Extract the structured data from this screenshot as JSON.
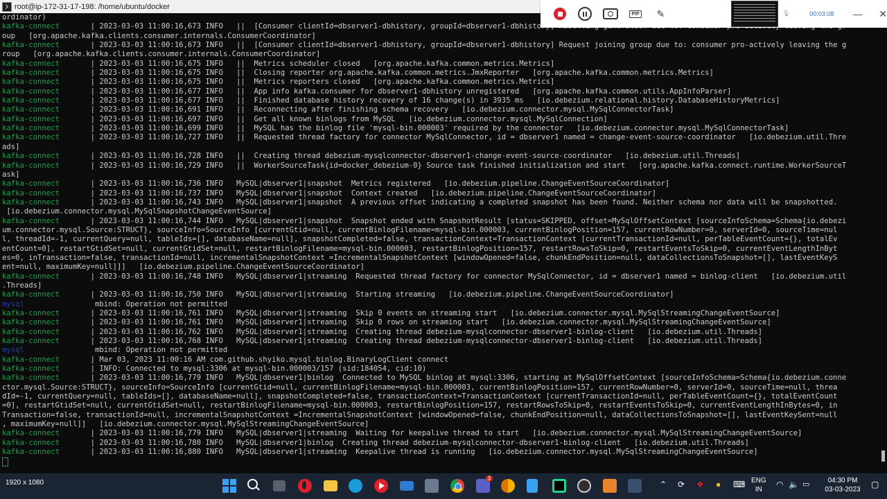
{
  "window": {
    "title": "root@ip-172-31-17-198: /home/ubuntu/docker"
  },
  "recorder": {
    "timer": "00:03:08",
    "buttons": [
      "stop-recording",
      "pause",
      "camera",
      "picture-in-picture",
      "draw"
    ],
    "pip_label": "PIP",
    "minimize": "—",
    "close": "✕"
  },
  "terminal": {
    "lines": [
      {
        "svc": "",
        "text": "ordinator)"
      },
      {
        "svc": "kafka-connect",
        "text": "       | 2023-03-03 11:00:16,673 INFO   ||  [Consumer clientId=dbserver1-dbhistory, groupId=dbserver1-dbhistory] Resetting generation due to: consumer pro-actively leaving the gr"
      },
      {
        "svc": "",
        "text": "oup   [org.apache.kafka.clients.consumer.internals.ConsumerCoordinator]"
      },
      {
        "svc": "kafka-connect",
        "text": "       | 2023-03-03 11:00:16,673 INFO   ||  [Consumer clientId=dbserver1-dbhistory, groupId=dbserver1-dbhistory] Request joining group due to: consumer pro-actively leaving the g"
      },
      {
        "svc": "",
        "text": "roup   [org.apache.kafka.clients.consumer.internals.ConsumerCoordinator]"
      },
      {
        "svc": "kafka-connect",
        "text": "       | 2023-03-03 11:00:16,675 INFO   ||  Metrics scheduler closed   [org.apache.kafka.common.metrics.Metrics]"
      },
      {
        "svc": "kafka-connect",
        "text": "       | 2023-03-03 11:00:16,675 INFO   ||  Closing reporter org.apache.kafka.common.metrics.JmxReporter   [org.apache.kafka.common.metrics.Metrics]"
      },
      {
        "svc": "kafka-connect",
        "text": "       | 2023-03-03 11:00:16,675 INFO   ||  Metrics reporters closed   [org.apache.kafka.common.metrics.Metrics]"
      },
      {
        "svc": "kafka-connect",
        "text": "       | 2023-03-03 11:00:16,677 INFO   ||  App info kafka.consumer for dbserver1-dbhistory unregistered   [org.apache.kafka.common.utils.AppInfoParser]"
      },
      {
        "svc": "kafka-connect",
        "text": "       | 2023-03-03 11:00:16,677 INFO   ||  Finished database history recovery of 16 change(s) in 3935 ms   [io.debezium.relational.history.DatabaseHistoryMetrics]"
      },
      {
        "svc": "kafka-connect",
        "text": "       | 2023-03-03 11:00:16,691 INFO   ||  Reconnecting after finishing schema recovery   [io.debezium.connector.mysql.MySqlConnectorTask]"
      },
      {
        "svc": "kafka-connect",
        "text": "       | 2023-03-03 11:00:16,697 INFO   ||  Get all known binlogs from MySQL   [io.debezium.connector.mysql.MySqlConnection]"
      },
      {
        "svc": "kafka-connect",
        "text": "       | 2023-03-03 11:00:16,699 INFO   ||  MySQL has the binlog file 'mysql-bin.000003' required by the connector   [io.debezium.connector.mysql.MySqlConnectorTask]"
      },
      {
        "svc": "kafka-connect",
        "text": "       | 2023-03-03 11:00:16,727 INFO   ||  Requested thread factory for connector MySqlConnector, id = dbserver1 named = change-event-source-coordinator   [io.debezium.util.Thre"
      },
      {
        "svc": "",
        "text": "ads]"
      },
      {
        "svc": "kafka-connect",
        "text": "       | 2023-03-03 11:00:16,728 INFO   ||  Creating thread debezium-mysqlconnector-dbserver1-change-event-source-coordinator   [io.debezium.util.Threads]"
      },
      {
        "svc": "kafka-connect",
        "text": "       | 2023-03-03 11:00:16,729 INFO   ||  WorkerSourceTask{id=docker_debezium-0} Source task finished initialization and start   [org.apache.kafka.connect.runtime.WorkerSourceT"
      },
      {
        "svc": "",
        "text": "ask]"
      },
      {
        "svc": "kafka-connect",
        "text": "       | 2023-03-03 11:00:16,736 INFO   MySQL|dbserver1|snapshot  Metrics registered   [io.debezium.pipeline.ChangeEventSourceCoordinator]"
      },
      {
        "svc": "kafka-connect",
        "text": "       | 2023-03-03 11:00:16,737 INFO   MySQL|dbserver1|snapshot  Context created   [io.debezium.pipeline.ChangeEventSourceCoordinator]"
      },
      {
        "svc": "kafka-connect",
        "text": "       | 2023-03-03 11:00:16,743 INFO   MySQL|dbserver1|snapshot  A previous offset indicating a completed snapshot has been found. Neither schema nor data will be snapshotted."
      },
      {
        "svc": "",
        "text": " [io.debezium.connector.mysql.MySqlSnapshotChangeEventSource]"
      },
      {
        "svc": "kafka-connect",
        "text": "       | 2023-03-03 11:00:16,744 INFO   MySQL|dbserver1|snapshot  Snapshot ended with SnapshotResult [status=SKIPPED, offset=MySqlOffsetContext [sourceInfoSchema=Schema{io.debezi"
      },
      {
        "svc": "",
        "text": "um.connector.mysql.Source:STRUCT}, sourceInfo=SourceInfo [currentGtid=null, currentBinlogFilename=mysql-bin.000003, currentBinlogPosition=157, currentRowNumber=0, serverId=0, sourceTime=nul"
      },
      {
        "svc": "",
        "text": "l, threadId=-1, currentQuery=null, tableIds=[], databaseName=null], snapshotCompleted=false, transactionContext=TransactionContext [currentTransactionId=null, perTableEventCount={}, totalEv"
      },
      {
        "svc": "",
        "text": "entCount=0], restartGtidSet=null, currentGtidSet=null, restartBinlogFilename=mysql-bin.000003, restartBinlogPosition=157, restartRowsToSkip=0, restartEventsToSkip=0, currentEventLengthInByt"
      },
      {
        "svc": "",
        "text": "es=0, inTransaction=false, transactionId=null, incrementalSnapshotContext =IncrementalSnapshotContext [windowOpened=false, chunkEndPosition=null, dataCollectionsToSnapshot=[], lastEventKeyS"
      },
      {
        "svc": "",
        "text": "ent=null, maximumKey=null]]]   [io.debezium.pipeline.ChangeEventSourceCoordinator]"
      },
      {
        "svc": "kafka-connect",
        "text": "       | 2023-03-03 11:00:16,748 INFO   MySQL|dbserver1|streaming  Requested thread factory for connector MySqlConnector, id = dbserver1 named = binlog-client   [io.debezium.util"
      },
      {
        "svc": "",
        "text": ".Threads]"
      },
      {
        "svc": "kafka-connect",
        "text": "       | 2023-03-03 11:00:16,750 INFO   MySQL|dbserver1|streaming  Starting streaming   [io.debezium.pipeline.ChangeEventSourceCoordinator]"
      },
      {
        "svc": "mysql",
        "text": "                mbind: Operation not permitted"
      },
      {
        "svc": "kafka-connect",
        "text": "       | 2023-03-03 11:00:16,761 INFO   MySQL|dbserver1|streaming  Skip 0 events on streaming start   [io.debezium.connector.mysql.MySqlStreamingChangeEventSource]"
      },
      {
        "svc": "kafka-connect",
        "text": "       | 2023-03-03 11:00:16,761 INFO   MySQL|dbserver1|streaming  Skip 0 rows on streaming start   [io.debezium.connector.mysql.MySqlStreamingChangeEventSource]"
      },
      {
        "svc": "kafka-connect",
        "text": "       | 2023-03-03 11:00:16,762 INFO   MySQL|dbserver1|streaming  Creating thread debezium-mysqlconnector-dbserver1-binlog-client   [io.debezium.util.Threads]"
      },
      {
        "svc": "kafka-connect",
        "text": "       | 2023-03-03 11:00:16,768 INFO   MySQL|dbserver1|streaming  Creating thread debezium-mysqlconnector-dbserver1-binlog-client   [io.debezium.util.Threads]"
      },
      {
        "svc": "mysql",
        "text": "                mbind: Operation not permitted"
      },
      {
        "svc": "kafka-connect",
        "text": "       | Mar 03, 2023 11:00:16 AM com.github.shyiko.mysql.binlog.BinaryLogClient connect"
      },
      {
        "svc": "kafka-connect",
        "text": "       | INFO: Connected to mysql:3306 at mysql-bin.000003/157 (sid:184054, cid:10)"
      },
      {
        "svc": "kafka-connect",
        "text": "       | 2023-03-03 11:00:16,779 INFO   MySQL|dbserver1|binlog  Connected to MySQL binlog at mysql:3306, starting at MySqlOffsetContext [sourceInfoSchema=Schema{io.debezium.conne"
      },
      {
        "svc": "",
        "text": "ctor.mysql.Source:STRUCT}, sourceInfo=SourceInfo [currentGtid=null, currentBinlogFilename=mysql-bin.000003, currentBinlogPosition=157, currentRowNumber=0, serverId=0, sourceTime=null, threa"
      },
      {
        "svc": "",
        "text": "dId=-1, currentQuery=null, tableIds=[], databaseName=null], snapshotCompleted=false, transactionContext=TransactionContext [currentTransactionId=null, perTableEventCount={}, totalEventCount"
      },
      {
        "svc": "",
        "text": "=0], restartGtidSet=null, currentGtidSet=null, restartBinlogFilename=mysql-bin.000003, restartBinlogPosition=157, restartRowsToSkip=0, restartEventsToSkip=0, currentEventLengthInBytes=0, in"
      },
      {
        "svc": "",
        "text": "Transaction=false, transactionId=null, incrementalSnapshotContext =IncrementalSnapshotContext [windowOpened=false, chunkEndPosition=null, dataCollectionsToSnapshot=[], lastEventKeySent=null"
      },
      {
        "svc": "",
        "text": ", maximumKey=null]]   [io.debezium.connector.mysql.MySqlStreamingChangeEventSource]"
      },
      {
        "svc": "kafka-connect",
        "text": "       | 2023-03-03 11:00:16,779 INFO   MySQL|dbserver1|streaming  Waiting for keepalive thread to start   [io.debezium.connector.mysql.MySqlStreamingChangeEventSource]"
      },
      {
        "svc": "kafka-connect",
        "text": "       | 2023-03-03 11:00:16,780 INFO   MySQL|dbserver1|binlog  Creating thread debezium-mysqlconnector-dbserver1-binlog-client   [io.debezium.util.Threads]"
      },
      {
        "svc": "kafka-connect",
        "text": "       | 2023-03-03 11:00:16,880 INFO   MySQL|dbserver1|streaming  Keepalive thread is running   [io.debezium.connector.mysql.MySqlStreamingChangeEventSource]"
      }
    ]
  },
  "taskbar": {
    "resolution_overlay": "1920 x 1080",
    "apps": [
      "windows-start",
      "search",
      "task-view",
      "opera",
      "file-explorer",
      "edge",
      "youtube-music",
      "mail",
      "snipping-tool",
      "chrome",
      "teams",
      "chrome-canary",
      "notepad",
      "pycharm",
      "obs",
      "orange-app",
      "screen-recorder"
    ],
    "teams_badge": "3",
    "language": {
      "line1": "ENG",
      "line2": "IN"
    },
    "time": "04:30 PM",
    "date": "03-03-2023"
  }
}
